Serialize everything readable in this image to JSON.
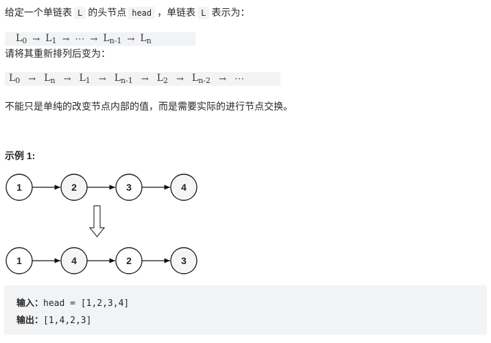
{
  "intro": {
    "part1": "给定一个单链表",
    "code_L": "L",
    "part2": "的头节点",
    "code_head": "head",
    "part3": "，单链表",
    "part4": "表示为："
  },
  "formula1": {
    "terms": [
      {
        "base": "L",
        "sub": "0"
      },
      {
        "base": "L",
        "sub": "1"
      },
      {
        "base": "⋯",
        "sub": ""
      },
      {
        "base": "L",
        "sub": "n-1"
      },
      {
        "base": "L",
        "sub": "n"
      }
    ],
    "arrow": "→"
  },
  "reorder_text": "请将其重新排列后变为：",
  "formula2": {
    "terms": [
      {
        "base": "L",
        "sub": "0"
      },
      {
        "base": "L",
        "sub": "n"
      },
      {
        "base": "L",
        "sub": "1"
      },
      {
        "base": "L",
        "sub": "n-1"
      },
      {
        "base": "L",
        "sub": "2"
      },
      {
        "base": "L",
        "sub": "n-2"
      },
      {
        "base": "⋯",
        "sub": ""
      }
    ],
    "arrow": "→"
  },
  "note": "不能只是单纯的改变节点内部的值，而是需要实际的进行节点交换。",
  "example": {
    "title": "示例 1:",
    "diagram": {
      "before": [
        "1",
        "2",
        "3",
        "4"
      ],
      "after": [
        "1",
        "4",
        "2",
        "3"
      ],
      "shaded_positions": [
        1,
        3
      ],
      "node_fill": "#f5f5f5",
      "down_arrow": "⇩"
    },
    "input_label": "输入：",
    "input_value": "head = [1,2,3,4]",
    "output_label": "输出：",
    "output_value": "[1,4,2,3]"
  }
}
